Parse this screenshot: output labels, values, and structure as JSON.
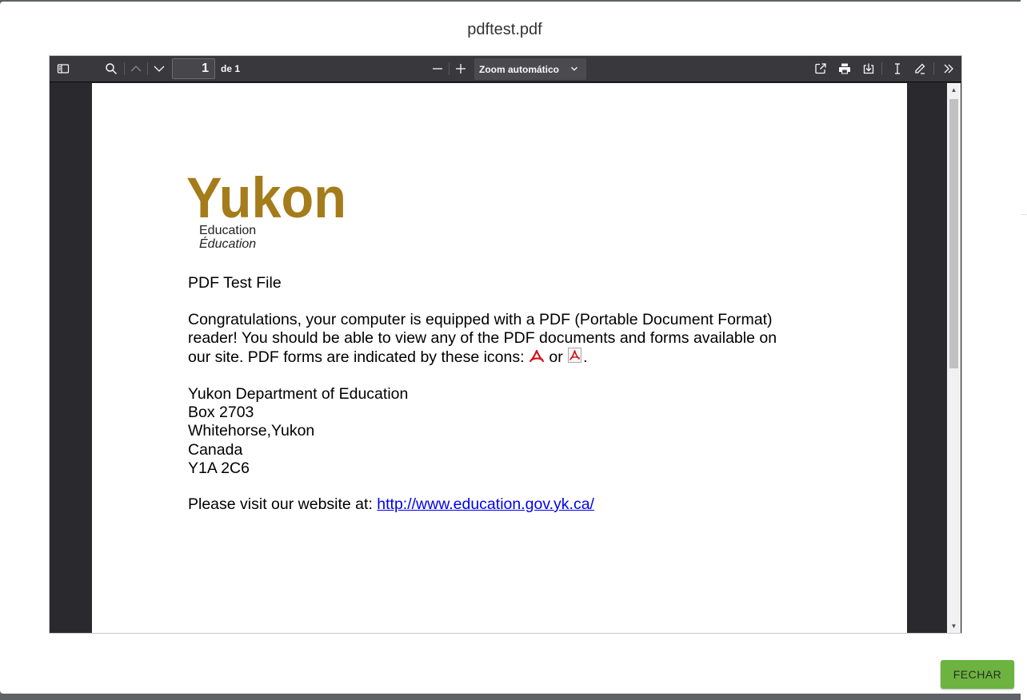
{
  "modal": {
    "title": "pdftest.pdf",
    "close_label": "FECHAR"
  },
  "toolbar": {
    "page_number": "1",
    "page_count": "de 1",
    "zoom_label": "Zoom automático",
    "icons": [
      "sidebar-toggle-icon",
      "search-icon",
      "previous-page-icon",
      "next-page-icon",
      "zoom-out-icon",
      "zoom-in-icon",
      "open-file-icon",
      "print-icon",
      "download-icon",
      "text-select-icon",
      "draw-icon",
      "tools-icon"
    ]
  },
  "document": {
    "logo_word": "Yukon",
    "logo_line1": "Education",
    "logo_line2": "Éducation",
    "title": "PDF Test File",
    "paragraph_line1": "Congratulations, your computer is equipped with a PDF (Portable Document Format)",
    "paragraph_line2": "reader!  You should be able to view any of the PDF documents and forms available on",
    "paragraph_line3_a": "our site.  PDF forms are indicated by these icons: ",
    "paragraph_line3_or": " or ",
    "paragraph_line3_end": ".",
    "address": [
      "Yukon Department of Education",
      "Box 2703",
      "Whitehorse,Yukon",
      "Canada",
      "Y1A 2C6"
    ],
    "website_prefix": "Please visit our website at:  ",
    "website_url": "http://www.education.gov.yk.ca/"
  },
  "colors": {
    "toolbar_bg": "#38383d",
    "viewer_bg": "#2a2a2e",
    "logo_gold": "#a57c1b",
    "button_green": "#6db33f",
    "link_blue": "#0000ee"
  }
}
